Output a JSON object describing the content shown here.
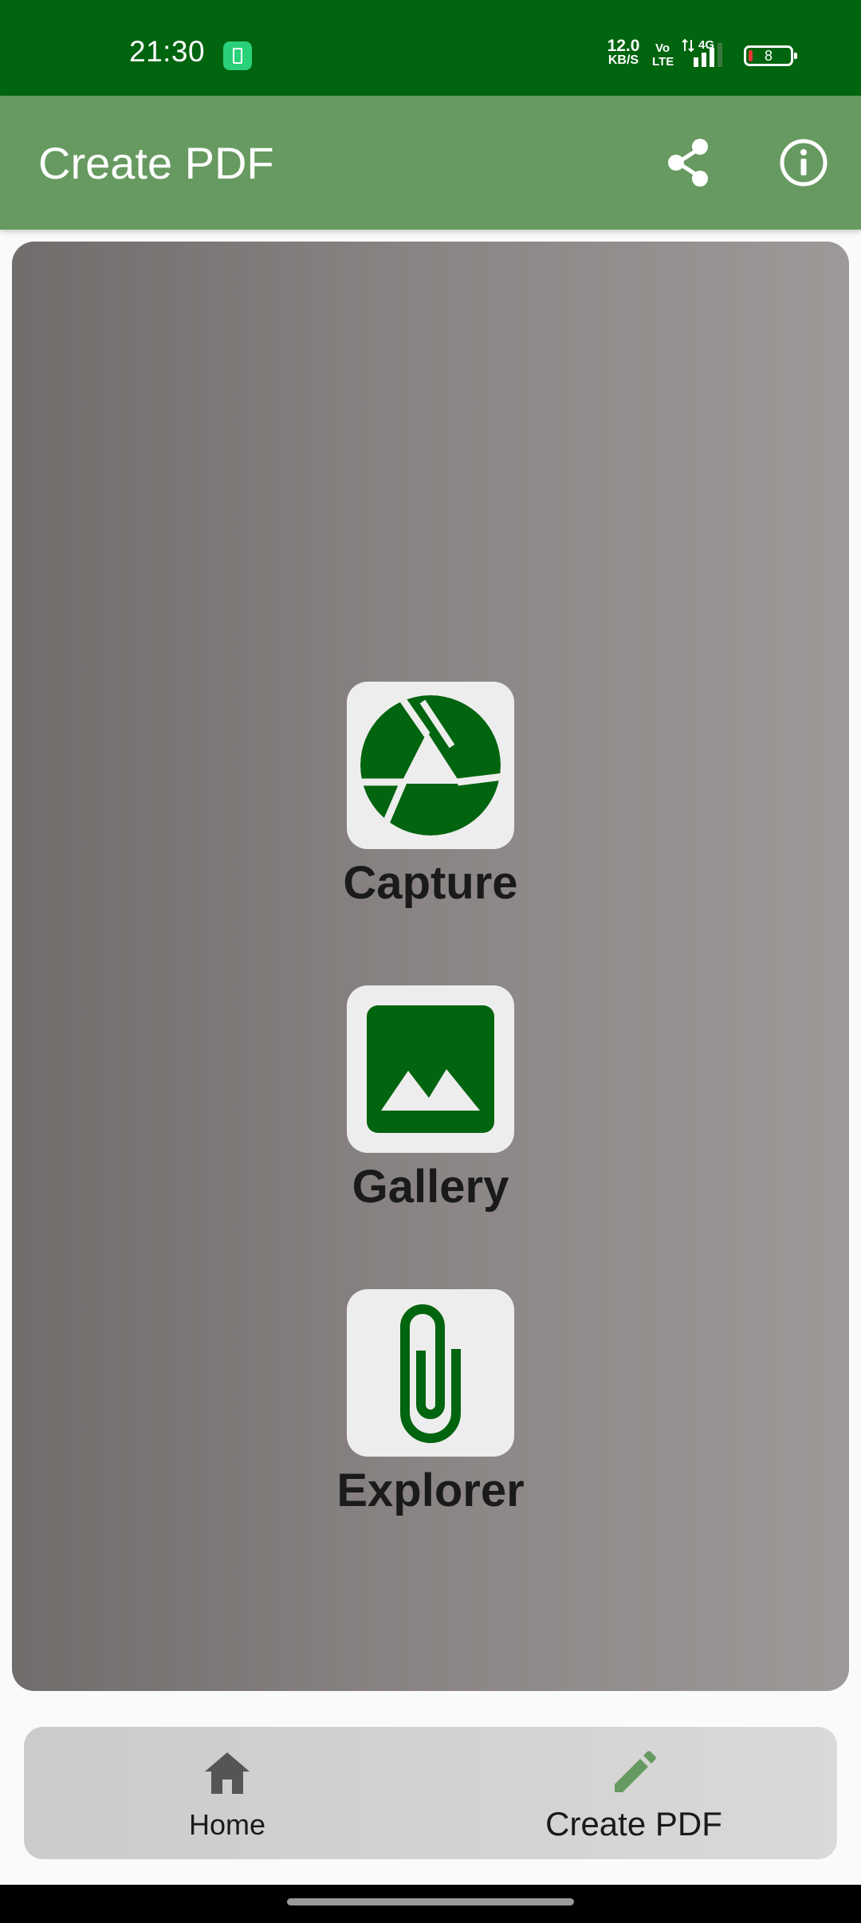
{
  "status_bar": {
    "time": "21:30",
    "net_speed_value": "12.0",
    "net_speed_unit": "KB/S",
    "volte_top": "Vo",
    "volte_bottom": "LTE",
    "network_type": "4G",
    "battery_level": "8"
  },
  "app_bar": {
    "title": "Create PDF",
    "background_color": "#679a60"
  },
  "actions": [
    {
      "label": "Capture",
      "icon": "camera-aperture-icon"
    },
    {
      "label": "Gallery",
      "icon": "image-icon"
    },
    {
      "label": "Explorer",
      "icon": "paperclip-icon"
    }
  ],
  "bottom_nav": {
    "items": [
      {
        "label": "Home",
        "icon": "home-icon",
        "selected": false
      },
      {
        "label": "Create PDF",
        "icon": "pencil-icon",
        "selected": true
      }
    ]
  },
  "colors": {
    "status_bar": "#01640f",
    "accent": "#679a60",
    "icon_green": "#01640f"
  }
}
